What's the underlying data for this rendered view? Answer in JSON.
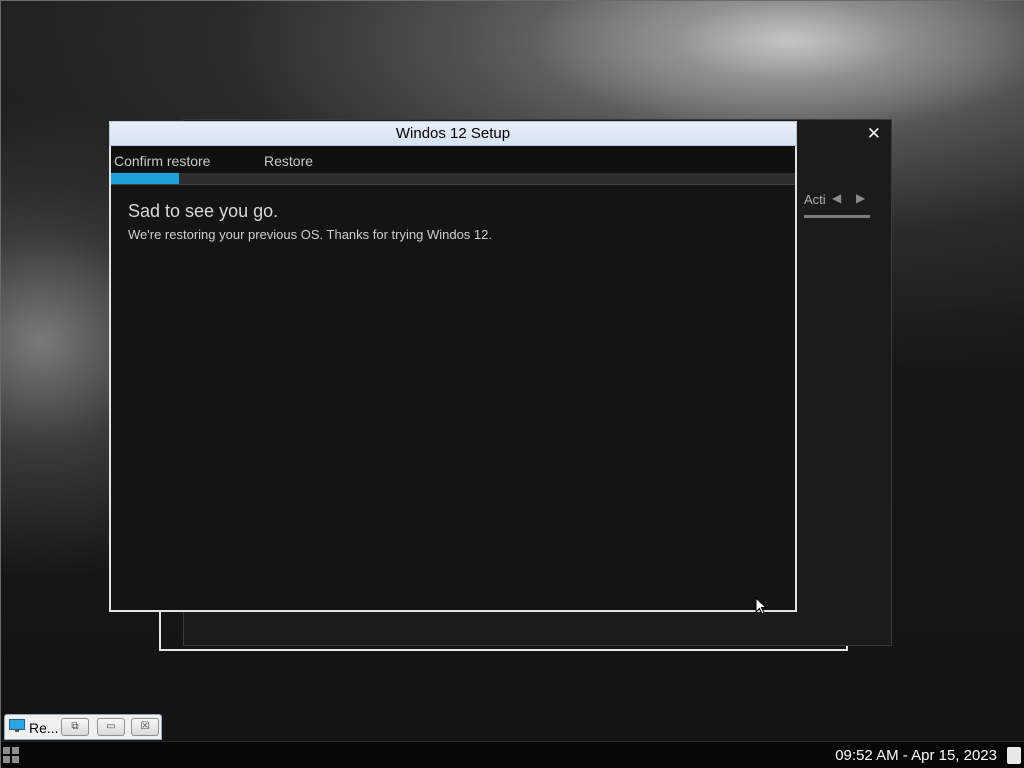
{
  "dialog": {
    "title": "Windos 12 Setup",
    "steps": [
      "Confirm restore",
      "Restore"
    ],
    "progress_percent": 10,
    "heading": "Sad to see you go.",
    "message": "We're restoring your previous OS. Thanks for trying Windos 12."
  },
  "background_window": {
    "close_glyph": "✕",
    "tab_label": "Acti"
  },
  "minimized_window": {
    "label": "Re...",
    "icon": "monitor-icon"
  },
  "taskbar": {
    "clock": "09:52 AM - Apr 15, 2023"
  },
  "colors": {
    "accent": "#1ea1d8",
    "dialog_bg": "#141414",
    "titlebar_bg": "#dde7f3"
  }
}
